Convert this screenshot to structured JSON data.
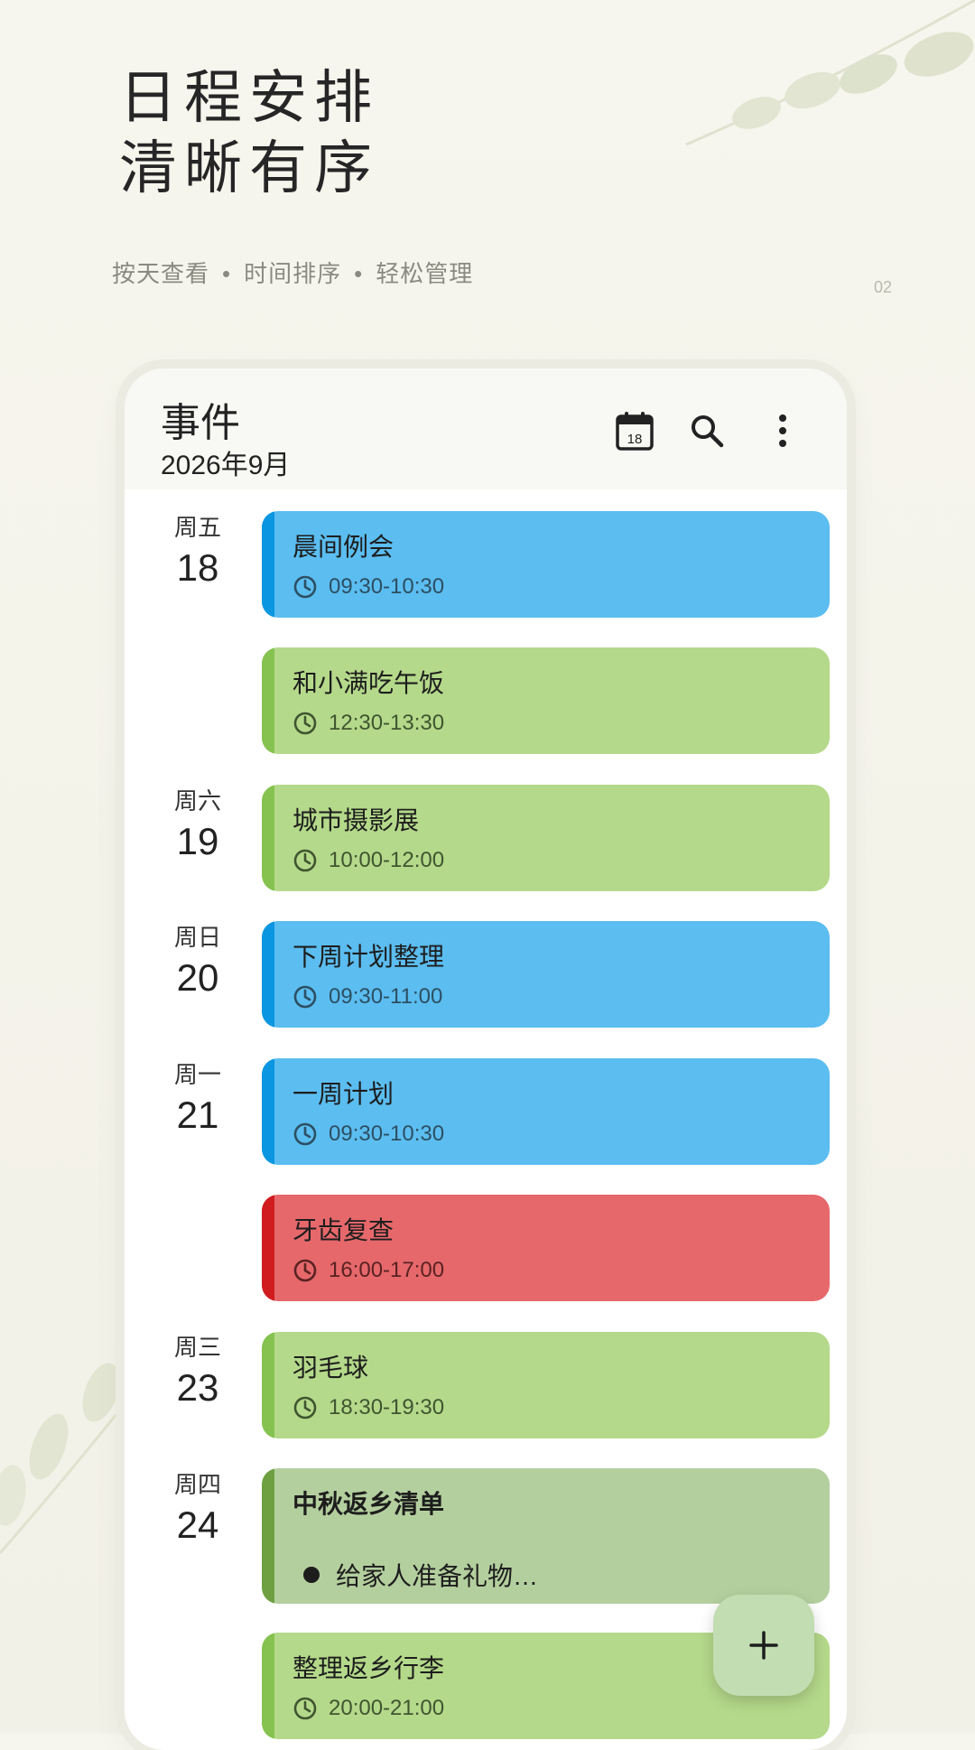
{
  "hero": {
    "title_line1": "日程安排",
    "title_line2": "清晰有序",
    "sub_1": "按天查看",
    "sub_2": "时间排序",
    "sub_3": "轻松管理",
    "separator": "•",
    "page_number": "02"
  },
  "app": {
    "title": "事件",
    "month": "2026年9月",
    "calendar_icon_day": "18",
    "icons": [
      "calendar-icon",
      "search-icon",
      "more-vert-icon"
    ]
  },
  "days": [
    {
      "weekday": "周五",
      "day": "18"
    },
    {
      "weekday": "周六",
      "day": "19"
    },
    {
      "weekday": "周日",
      "day": "20"
    },
    {
      "weekday": "周一",
      "day": "21"
    },
    {
      "weekday": "周三",
      "day": "23"
    },
    {
      "weekday": "周四",
      "day": "24"
    }
  ],
  "events": [
    {
      "title": "晨间例会",
      "time": "09:30-10:30",
      "color": "#5bbdf0"
    },
    {
      "title": "和小满吃午饭",
      "time": "12:30-13:30",
      "color": "#b4d98a"
    },
    {
      "title": "城市摄影展",
      "time": "10:00-12:00",
      "color": "#b4d98a"
    },
    {
      "title": "下周计划整理",
      "time": "09:30-11:00",
      "color": "#5bbdf0"
    },
    {
      "title": "一周计划",
      "time": "09:30-10:30",
      "color": "#5bbdf0"
    },
    {
      "title": "牙齿复查",
      "time": "16:00-17:00",
      "color": "#e6686b"
    },
    {
      "title": "羽毛球",
      "time": "18:30-19:30",
      "color": "#b4d98a"
    },
    {
      "title": "中秋返乡清单",
      "item": "给家人准备礼物…",
      "color": "#b4cf9e"
    },
    {
      "title": "整理返乡行李",
      "time": "20:00-21:00",
      "color": "#b4d98a"
    }
  ],
  "fab": {
    "label": "+"
  }
}
